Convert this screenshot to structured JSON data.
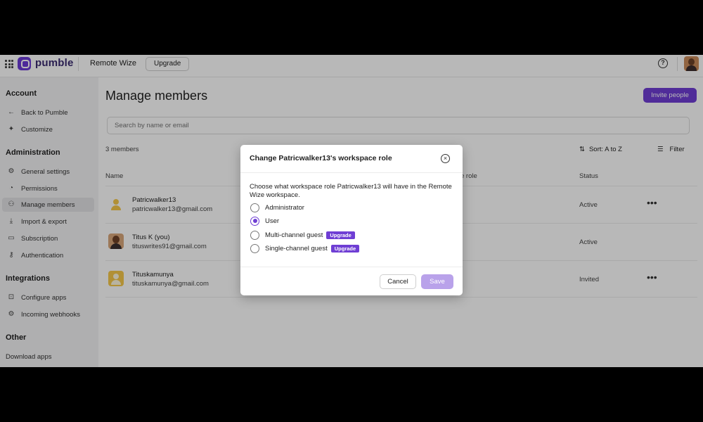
{
  "topbar": {
    "app_name": "pumble",
    "workspace": "Remote Wize",
    "upgrade_label": "Upgrade",
    "help_glyph": "?"
  },
  "sidebar": {
    "sections": [
      "Account",
      "Administration",
      "Integrations",
      "Other"
    ],
    "account_items": [
      {
        "label": "Back to Pumble",
        "icon": "arrow-left-icon"
      },
      {
        "label": "Customize",
        "icon": "sparkle-icon"
      }
    ],
    "admin_items": [
      {
        "label": "General settings",
        "icon": "gear-icon"
      },
      {
        "label": "Permissions",
        "icon": "shield-icon"
      },
      {
        "label": "Manage members",
        "icon": "users-icon",
        "active": true
      },
      {
        "label": "Import & export",
        "icon": "download-icon"
      },
      {
        "label": "Subscription",
        "icon": "card-icon"
      },
      {
        "label": "Authentication",
        "icon": "key-icon"
      }
    ],
    "integration_items": [
      {
        "label": "Configure apps",
        "icon": "apps-icon"
      },
      {
        "label": "Incoming webhooks",
        "icon": "webhook-icon"
      }
    ],
    "other_items": [
      {
        "label": "Download apps"
      }
    ]
  },
  "main": {
    "title": "Manage members",
    "invite_label": "Invite people",
    "search_placeholder": "Search by name or email",
    "member_count": "3 members",
    "sort_label": "Sort: A to Z",
    "filter_label": "Filter",
    "columns": {
      "name": "Name",
      "role": "e role",
      "status": "Status"
    },
    "members": [
      {
        "name": "Patricwalker13",
        "email": "patricwalker13@gmail.com",
        "status": "Active",
        "more": "•••"
      },
      {
        "name": "Titus K (you)",
        "email": "tituswrites91@gmail.com",
        "status": "Active",
        "more": ""
      },
      {
        "name": "Tituskamunya",
        "email": "tituskamunya@gmail.com",
        "status": "Invited",
        "more": "•••"
      }
    ]
  },
  "modal": {
    "title": "Change Patricwalker13's workspace role",
    "close_glyph": "×",
    "description": "Choose what workspace role Patricwalker13 will have in the Remote Wize workspace.",
    "options": [
      {
        "label": "Administrator",
        "checked": false,
        "badge": ""
      },
      {
        "label": "User",
        "checked": true,
        "badge": ""
      },
      {
        "label": "Multi-channel guest",
        "checked": false,
        "badge": "Upgrade"
      },
      {
        "label": "Single-channel guest",
        "checked": false,
        "badge": "Upgrade"
      }
    ],
    "cancel_label": "Cancel",
    "save_label": "Save"
  },
  "colors": {
    "accent": "#6f3ed4",
    "save_disabled": "#b9a2ea"
  }
}
